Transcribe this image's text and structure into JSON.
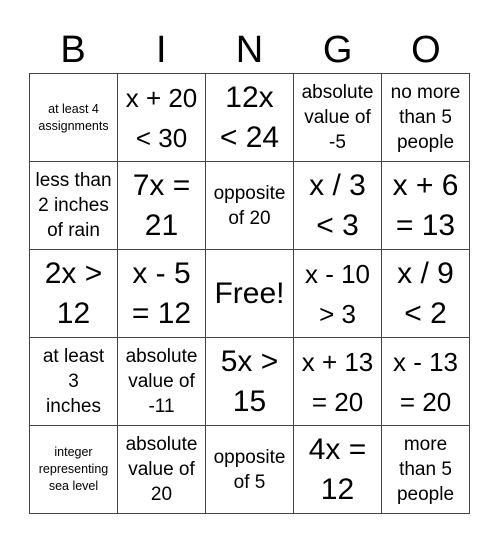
{
  "header": {
    "letters": [
      "B",
      "I",
      "N",
      "G",
      "O"
    ]
  },
  "cells": [
    {
      "text": "at least 4\nassignments",
      "size": "xs"
    },
    {
      "text": "x + 20\n< 30",
      "size": "lg"
    },
    {
      "text": "12x\n< 24",
      "size": "xl"
    },
    {
      "text": "absolute\nvalue of\n-5",
      "size": "sm"
    },
    {
      "text": "no more\nthan 5\npeople",
      "size": "sm"
    },
    {
      "text": "less than\n2 inches\nof rain",
      "size": "sm"
    },
    {
      "text": "7x =\n21",
      "size": "xl"
    },
    {
      "text": "opposite\nof 20",
      "size": "sm"
    },
    {
      "text": "x / 3\n< 3",
      "size": "xl"
    },
    {
      "text": "x + 6\n= 13",
      "size": "xl"
    },
    {
      "text": "2x >\n12",
      "size": "xl"
    },
    {
      "text": "x - 5\n= 12",
      "size": "xl"
    },
    {
      "text": "Free!",
      "size": "free"
    },
    {
      "text": "x - 10\n> 3",
      "size": "lg"
    },
    {
      "text": "x / 9\n< 2",
      "size": "xl"
    },
    {
      "text": "at least\n3\ninches",
      "size": "sm"
    },
    {
      "text": "absolute\nvalue of\n-11",
      "size": "sm"
    },
    {
      "text": "5x >\n15",
      "size": "xl"
    },
    {
      "text": "x + 13\n= 20",
      "size": "lg"
    },
    {
      "text": "x - 13\n= 20",
      "size": "lg"
    },
    {
      "text": "integer\nrepresenting\nsea level",
      "size": "xs"
    },
    {
      "text": "absolute\nvalue of\n20",
      "size": "sm"
    },
    {
      "text": "opposite\nof 5",
      "size": "sm"
    },
    {
      "text": "4x =\n12",
      "size": "xl"
    },
    {
      "text": "more\nthan 5\npeople",
      "size": "sm"
    }
  ]
}
